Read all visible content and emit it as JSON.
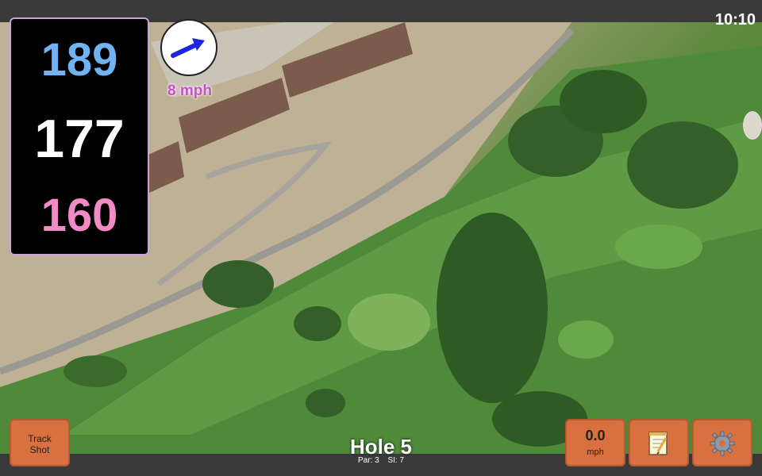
{
  "status": {
    "time": "10:10"
  },
  "distances": {
    "back": "189",
    "middle": "177",
    "front": "160"
  },
  "wind": {
    "speed_label": "8 mph",
    "icon": "wind-arrow-icon"
  },
  "hole": {
    "title": "Hole 5",
    "par": "Par: 3",
    "stroke_index": "SI: 7"
  },
  "buttons": {
    "track_shot": [
      "Track",
      "Shot"
    ],
    "speed_value": "0.0",
    "speed_unit": "mph",
    "notes_icon": "notepad-icon",
    "settings_icon": "gear-icon"
  },
  "colors": {
    "button_bg": "#d8703f",
    "back_distance": "#6fb3f3",
    "front_distance": "#f28ac6",
    "wind_text": "#c94ec8",
    "wind_arrow": "#1d24e0"
  }
}
